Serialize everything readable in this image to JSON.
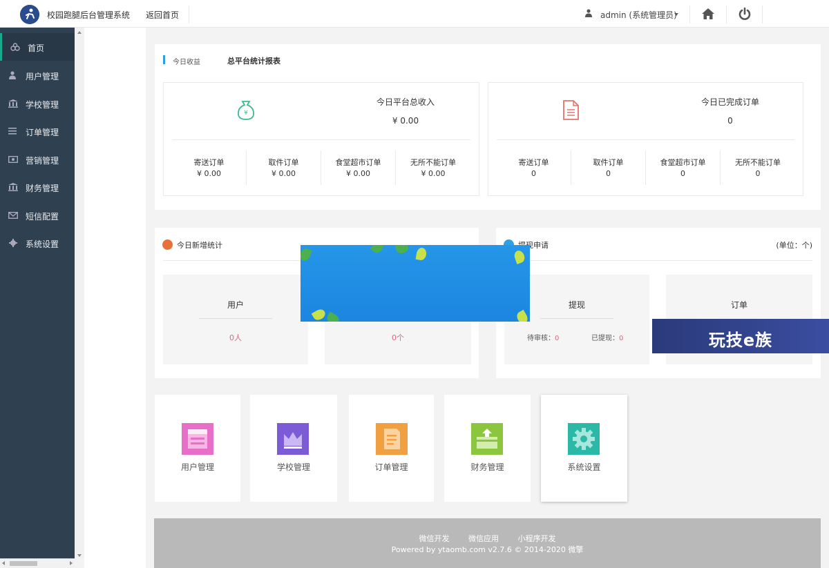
{
  "header": {
    "app_title": "校园跑腿后台管理系统",
    "back_home": "返回首页",
    "user": "admin (系统管理员)",
    "logo_icon": "runner-logo-icon",
    "home_icon": "home-icon",
    "power_icon": "power-icon"
  },
  "sidebar": {
    "items": [
      {
        "label": "首页",
        "icon": "dashboard-icon"
      },
      {
        "label": "用户管理",
        "icon": "user-icon"
      },
      {
        "label": "学校管理",
        "icon": "bank-icon"
      },
      {
        "label": "订单管理",
        "icon": "list-icon"
      },
      {
        "label": "营销管理",
        "icon": "money-icon"
      },
      {
        "label": "财务管理",
        "icon": "bank-icon"
      },
      {
        "label": "短信配置",
        "icon": "mail-icon"
      },
      {
        "label": "系统设置",
        "icon": "gear-icon"
      }
    ],
    "active_index": 0
  },
  "stats": {
    "today_label": "今日收益",
    "title": "总平台统计报表",
    "income": {
      "heading": "今日平台总收入",
      "value": "¥ 0.00",
      "icon": "money-bag-icon",
      "cells": [
        {
          "label": "寄送订单",
          "value": "¥ 0.00"
        },
        {
          "label": "取件订单",
          "value": "¥ 0.00"
        },
        {
          "label": "食堂超市订单",
          "value": "¥ 0.00"
        },
        {
          "label": "无所不能订单",
          "value": "¥ 0.00"
        }
      ]
    },
    "orders": {
      "heading": "今日已完成订单",
      "value": "0",
      "icon": "document-icon",
      "cells": [
        {
          "label": "寄送订单",
          "value": "0"
        },
        {
          "label": "取件订单",
          "value": "0"
        },
        {
          "label": "食堂超市订单",
          "value": "0"
        },
        {
          "label": "无所不能订单",
          "value": "0"
        }
      ]
    }
  },
  "new_stats": {
    "title": "今日新增统计",
    "users": {
      "label": "用户",
      "value": "0人"
    },
    "orders": {
      "value": "0个"
    }
  },
  "withdraw": {
    "title": "提现申请",
    "unit": "(单位：个)",
    "withdraw_box": {
      "label": "提现",
      "pending_label": "待审核：",
      "pending": "0",
      "done_label": "已提现：",
      "done": "0"
    },
    "order_box": {
      "label": "订单"
    }
  },
  "tiles": [
    {
      "label": "用户管理",
      "icon": "user-card-icon",
      "color": "#e86fc7"
    },
    {
      "label": "学校管理",
      "icon": "crown-icon",
      "color": "#7d5bd6"
    },
    {
      "label": "订单管理",
      "icon": "order-doc-icon",
      "color": "#f0a041"
    },
    {
      "label": "财务管理",
      "icon": "wallet-icon",
      "color": "#8cc63f"
    },
    {
      "label": "系统设置",
      "icon": "gear-icon",
      "color": "#2bb8a6"
    }
  ],
  "footer": {
    "links": [
      "微信开发",
      "微信应用",
      "小程序开发"
    ],
    "copyright": "Powered by ytaomb.com v2.7.6 © 2014-2020 微擎"
  },
  "watermark": "玩技e族",
  "colors": {
    "sidebar_bg": "#2f4050",
    "accent": "#19aa8d",
    "value_red": "#d3697f"
  }
}
